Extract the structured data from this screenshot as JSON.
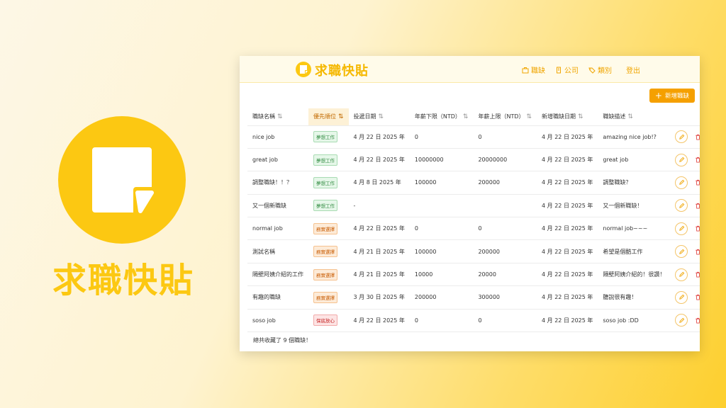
{
  "brand": {
    "title": "求職快貼"
  },
  "app": {
    "name": "求職快貼",
    "nav": [
      {
        "label": "職缺",
        "icon": "briefcase-icon"
      },
      {
        "label": "公司",
        "icon": "building-icon"
      },
      {
        "label": "類別",
        "icon": "tag-icon"
      }
    ],
    "logout": "登出",
    "add_button": "新增職缺",
    "columns": [
      {
        "label": "職缺名稱",
        "sort": "⇅"
      },
      {
        "label": "優先順位",
        "sort": "⇅"
      },
      {
        "label": "投遞日期",
        "sort": "⇅"
      },
      {
        "label": "年薪下限（NTD）",
        "sort": "⇅"
      },
      {
        "label": "年薪上限（NTD）",
        "sort": "⇅"
      },
      {
        "label": "新增職缺日期",
        "sort": "⇅"
      },
      {
        "label": "職缺描述",
        "sort": "⇅"
      }
    ],
    "rows": [
      {
        "name": "nice job",
        "priority": "夢想工作",
        "ptype": "dream",
        "applied": "4 月 22 日 2025 年",
        "min": "0",
        "max": "0",
        "added": "4 月 22 日 2025 年",
        "desc": "amazing nice job!?"
      },
      {
        "name": "great job",
        "priority": "夢想工作",
        "ptype": "dream",
        "applied": "4 月 22 日 2025 年",
        "min": "10000000",
        "max": "20000000",
        "added": "4 月 22 日 2025 年",
        "desc": "great job"
      },
      {
        "name": "調整職缺！！？",
        "priority": "夢想工作",
        "ptype": "dream",
        "applied": "4 月 8 日 2025 年",
        "min": "100000",
        "max": "200000",
        "added": "4 月 22 日 2025 年",
        "desc": "調整職缺？"
      },
      {
        "name": "又一個新職缺",
        "priority": "夢想工作",
        "ptype": "dream",
        "applied": "-",
        "min": "",
        "max": "",
        "added": "4 月 22 日 2025 年",
        "desc": "又一個新職缺！"
      },
      {
        "name": "normal job",
        "priority": "務實選擇",
        "ptype": "practical",
        "applied": "4 月 22 日 2025 年",
        "min": "0",
        "max": "0",
        "added": "4 月 22 日 2025 年",
        "desc": "normal job~~~"
      },
      {
        "name": "測試名稱",
        "priority": "務實選擇",
        "ptype": "practical",
        "applied": "4 月 21 日 2025 年",
        "min": "100000",
        "max": "200000",
        "added": "4 月 22 日 2025 年",
        "desc": "希望是個酷工作"
      },
      {
        "name": "隔壁阿姨介紹的工作",
        "priority": "務實選擇",
        "ptype": "practical",
        "applied": "4 月 21 日 2025 年",
        "min": "10000",
        "max": "20000",
        "added": "4 月 22 日 2025 年",
        "desc": "隔壁阿姨介紹的！很讚！"
      },
      {
        "name": "有趣的職缺",
        "priority": "務實選擇",
        "ptype": "practical",
        "applied": "3 月 30 日 2025 年",
        "min": "200000",
        "max": "300000",
        "added": "4 月 22 日 2025 年",
        "desc": "聽說很有趣！"
      },
      {
        "name": "soso job",
        "priority": "保底放心",
        "ptype": "safe",
        "applied": "4 月 22 日 2025 年",
        "min": "0",
        "max": "0",
        "added": "4 月 22 日 2025 年",
        "desc": "soso job :DD"
      }
    ],
    "footer": "總共收藏了 9 個職缺！"
  },
  "colors": {
    "accent": "#fcc812",
    "button": "#f5a000",
    "dream": "#2f8a3f",
    "practical": "#c85a00",
    "safe": "#c42424"
  }
}
